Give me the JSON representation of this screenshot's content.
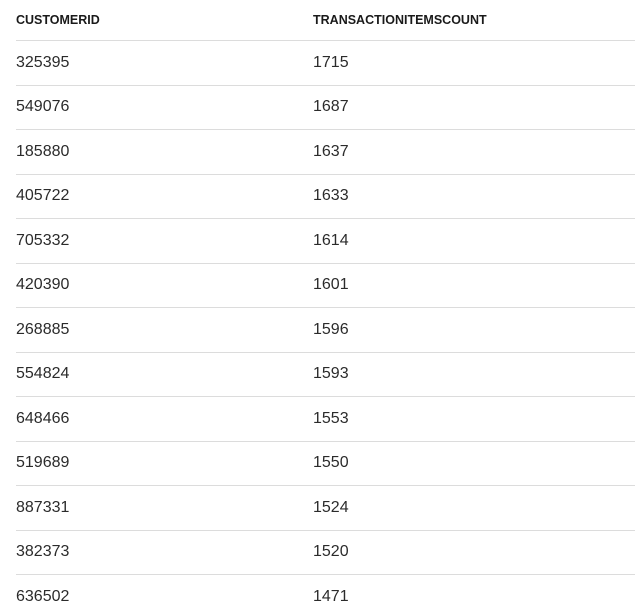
{
  "table": {
    "headers": [
      "CUSTOMERID",
      "TRANSACTIONITEMSCOUNT"
    ],
    "rows": [
      [
        "325395",
        "1715"
      ],
      [
        "549076",
        "1687"
      ],
      [
        "185880",
        "1637"
      ],
      [
        "405722",
        "1633"
      ],
      [
        "705332",
        "1614"
      ],
      [
        "420390",
        "1601"
      ],
      [
        "268885",
        "1596"
      ],
      [
        "554824",
        "1593"
      ],
      [
        "648466",
        "1553"
      ],
      [
        "519689",
        "1550"
      ],
      [
        "887331",
        "1524"
      ],
      [
        "382373",
        "1520"
      ],
      [
        "636502",
        "1471"
      ]
    ]
  }
}
